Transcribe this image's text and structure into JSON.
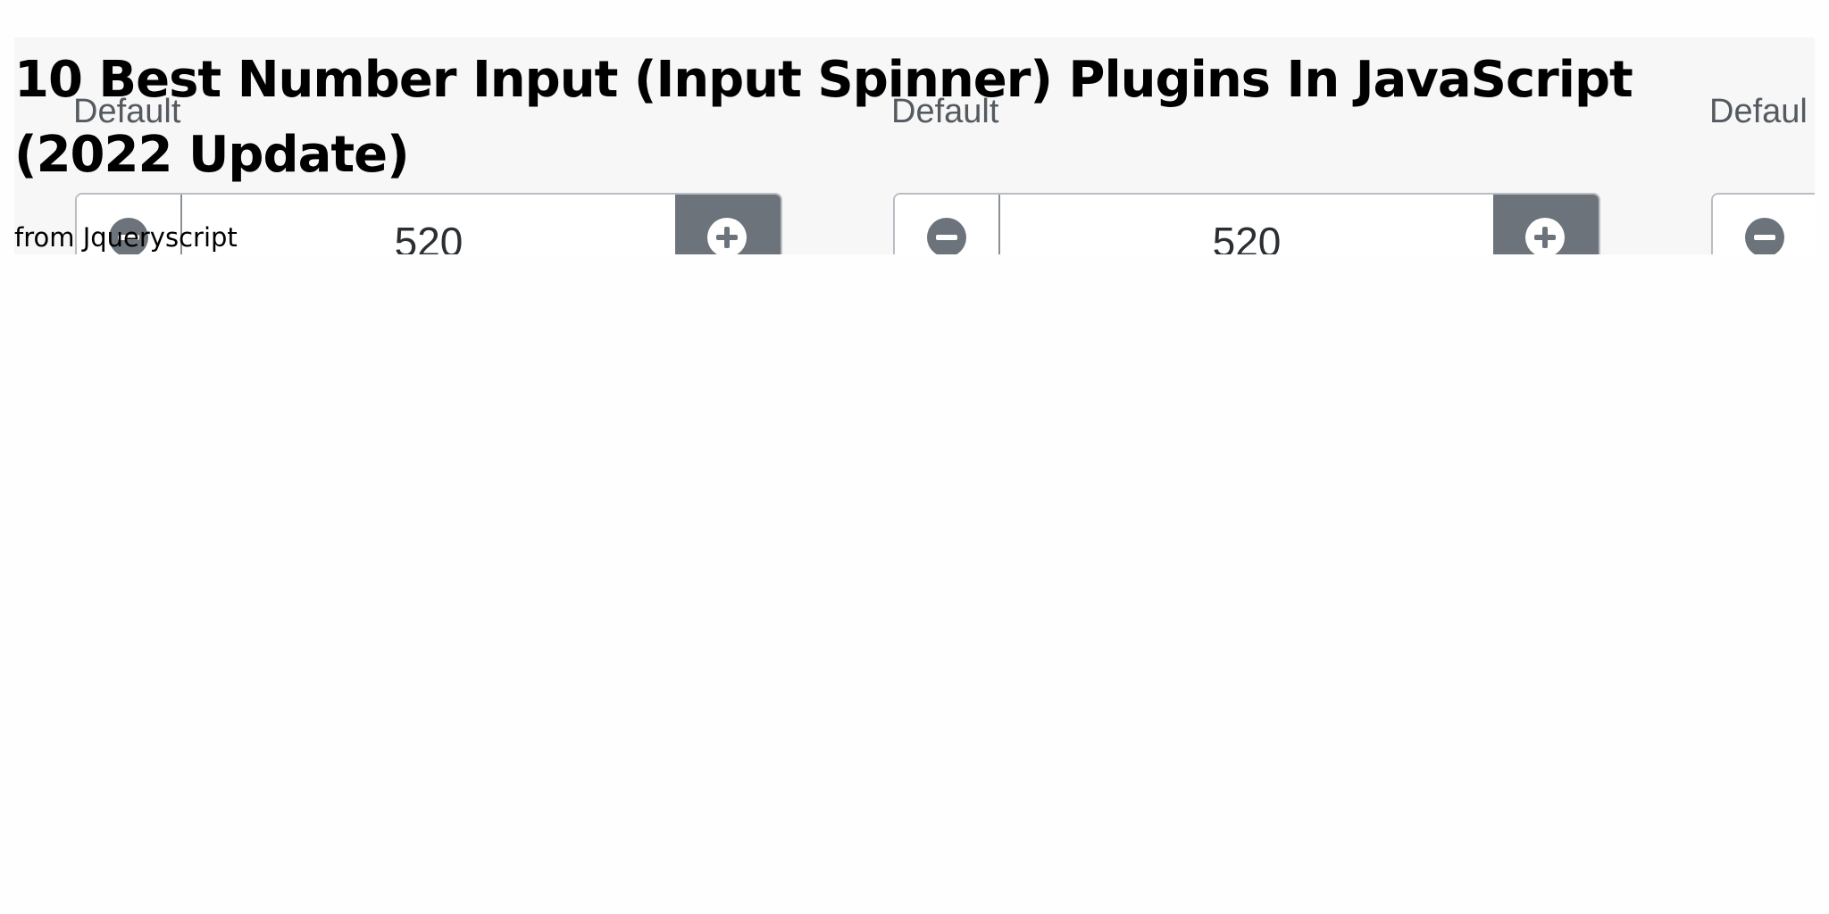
{
  "article": {
    "title": "10 Best Number Input (Input Spinner) Plugins In JavaScript (2022 Update)",
    "source": "from Jqueryscript"
  },
  "preview": {
    "demos": [
      {
        "label": "Default",
        "value": "520"
      },
      {
        "label": "Default",
        "value": "520"
      },
      {
        "label": "Defaul"
      }
    ],
    "icons": {
      "decrement": "minus-circle-icon",
      "increment": "plus-circle-icon"
    },
    "colors": {
      "button_dark": "#6c737a",
      "label_text": "#555a60",
      "value_text": "#2b2f33"
    }
  }
}
